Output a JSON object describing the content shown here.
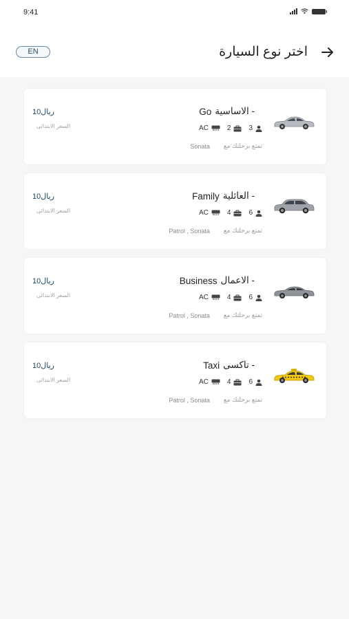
{
  "status_bar": {
    "time": "9:41",
    "icons": [
      "signal-icon",
      "wifi-icon",
      "battery-icon"
    ]
  },
  "header": {
    "title": "اختر نوع السيارة",
    "language_button": "EN",
    "back_icon": "arrow-right-icon"
  },
  "colors": {
    "accent": "#1d4563",
    "background": "#f6f6f6",
    "card": "#ffffff"
  },
  "cars": [
    {
      "name_ar": "- الاساسية",
      "name_en": "Go",
      "passengers": "3",
      "bags": "2",
      "ac": "AC",
      "enjoy_text": "تمتع برحلتك مع",
      "models": "Sonata",
      "price": "10ريال",
      "price_label": "السعر الابتدائى",
      "image": "silver-sedan"
    },
    {
      "name_ar": "- العائلية",
      "name_en": "Family",
      "passengers": "6",
      "bags": "4",
      "ac": "AC",
      "enjoy_text": "تمتع برحلتك مع",
      "models": "Patrol ,  Sonata",
      "price": "10ريال",
      "price_label": "السعر الابتدائى",
      "image": "grey-suv"
    },
    {
      "name_ar": "- الاعمال",
      "name_en": "Business",
      "passengers": "6",
      "bags": "4",
      "ac": "AC",
      "enjoy_text": "تمتع برحلتك مع",
      "models": "Patrol ,  Sonata",
      "price": "10ريال",
      "price_label": "السعر الابتدائى",
      "image": "grey-sedan"
    },
    {
      "name_ar": "- تاكسى",
      "name_en": "Taxi",
      "passengers": "6",
      "bags": "4",
      "ac": "AC",
      "enjoy_text": "تمتع برحلتك مع",
      "models": "Patrol ,  Sonata",
      "price": "10ريال",
      "price_label": "السعر الابتدائى",
      "image": "yellow-taxi"
    }
  ]
}
